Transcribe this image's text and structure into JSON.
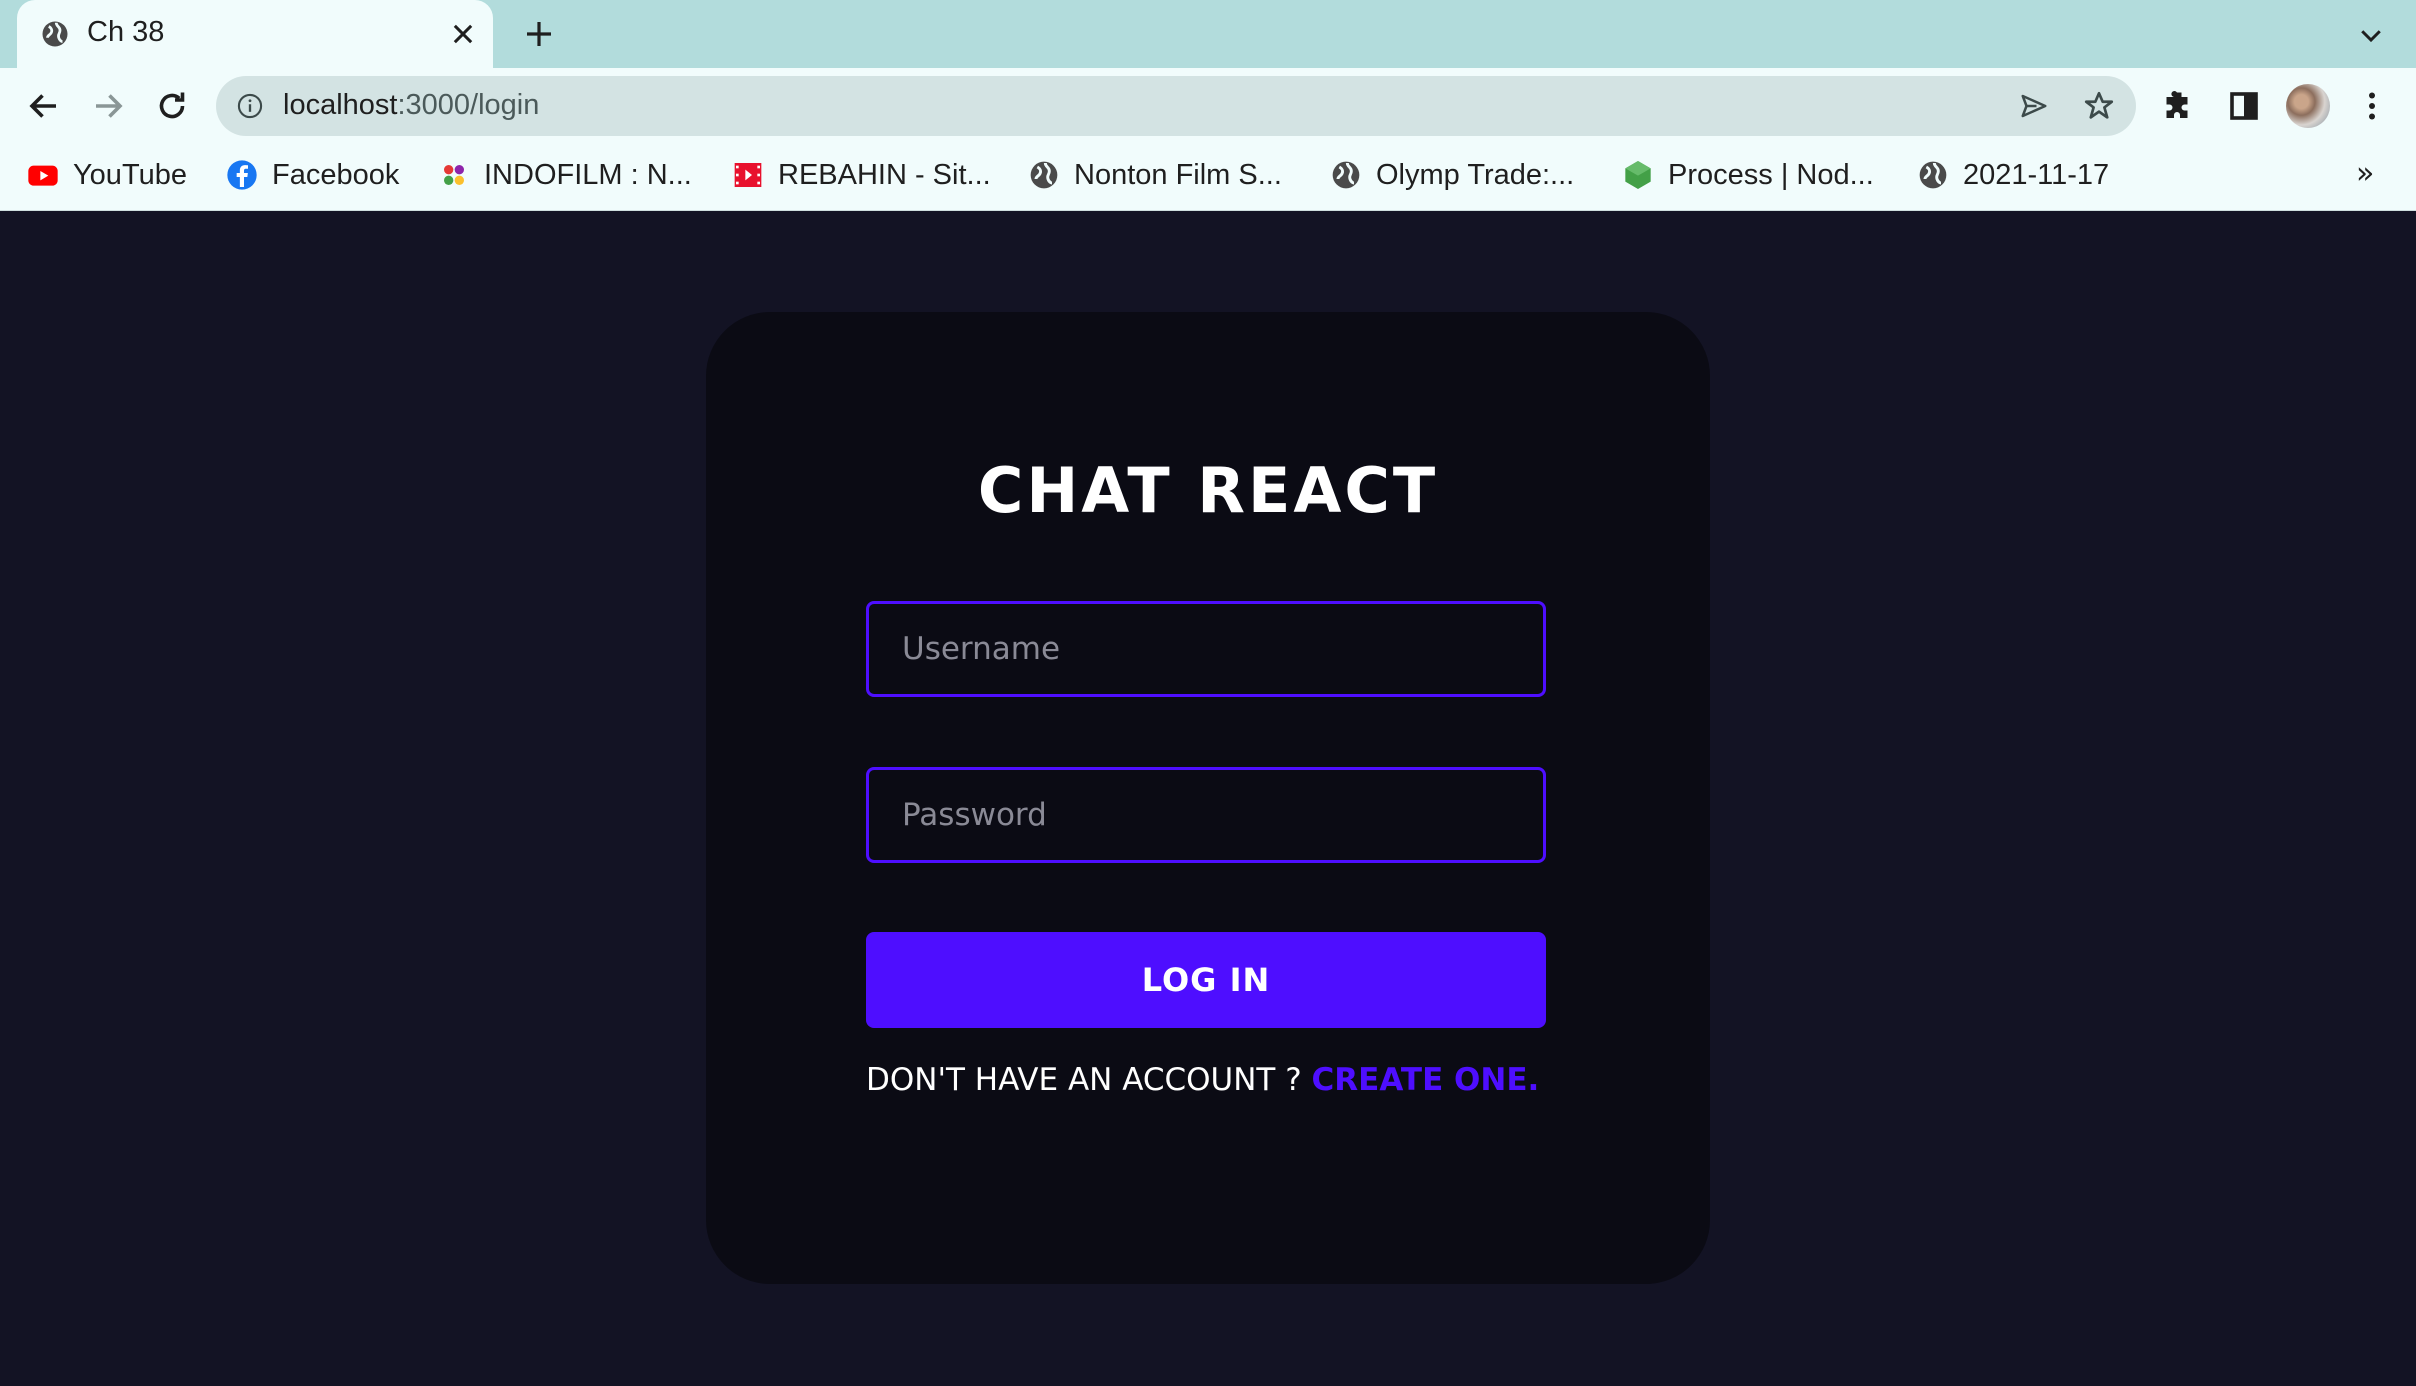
{
  "browser": {
    "tab": {
      "title": "Ch 38"
    },
    "address": {
      "host": "localhost",
      "path": ":3000/login"
    },
    "bookmarks": [
      {
        "label": "YouTube",
        "icon": "youtube-icon"
      },
      {
        "label": "Facebook",
        "icon": "facebook-icon"
      },
      {
        "label": "INDOFILM : N...",
        "icon": "indofilm-icon"
      },
      {
        "label": "REBAHIN - Sit...",
        "icon": "rebahin-icon"
      },
      {
        "label": "Nonton Film S...",
        "icon": "globe-icon"
      },
      {
        "label": "Olymp Trade:...",
        "icon": "globe-icon"
      },
      {
        "label": "Process | Nod...",
        "icon": "nodejs-icon"
      },
      {
        "label": "2021-11-17",
        "icon": "globe-icon"
      }
    ],
    "bookmarks_overflow": "»"
  },
  "login": {
    "brand": "CHAT REACT",
    "username_placeholder": "Username",
    "password_placeholder": "Password",
    "submit_label": "LOG IN",
    "prompt": "DON'T HAVE AN ACCOUNT ? ",
    "create_link": "CREATE ONE."
  },
  "colors": {
    "accent": "#4e0eff",
    "page_background": "#131324",
    "card_background": "#0b0b14",
    "tabstrip": "#b2dcdc"
  }
}
